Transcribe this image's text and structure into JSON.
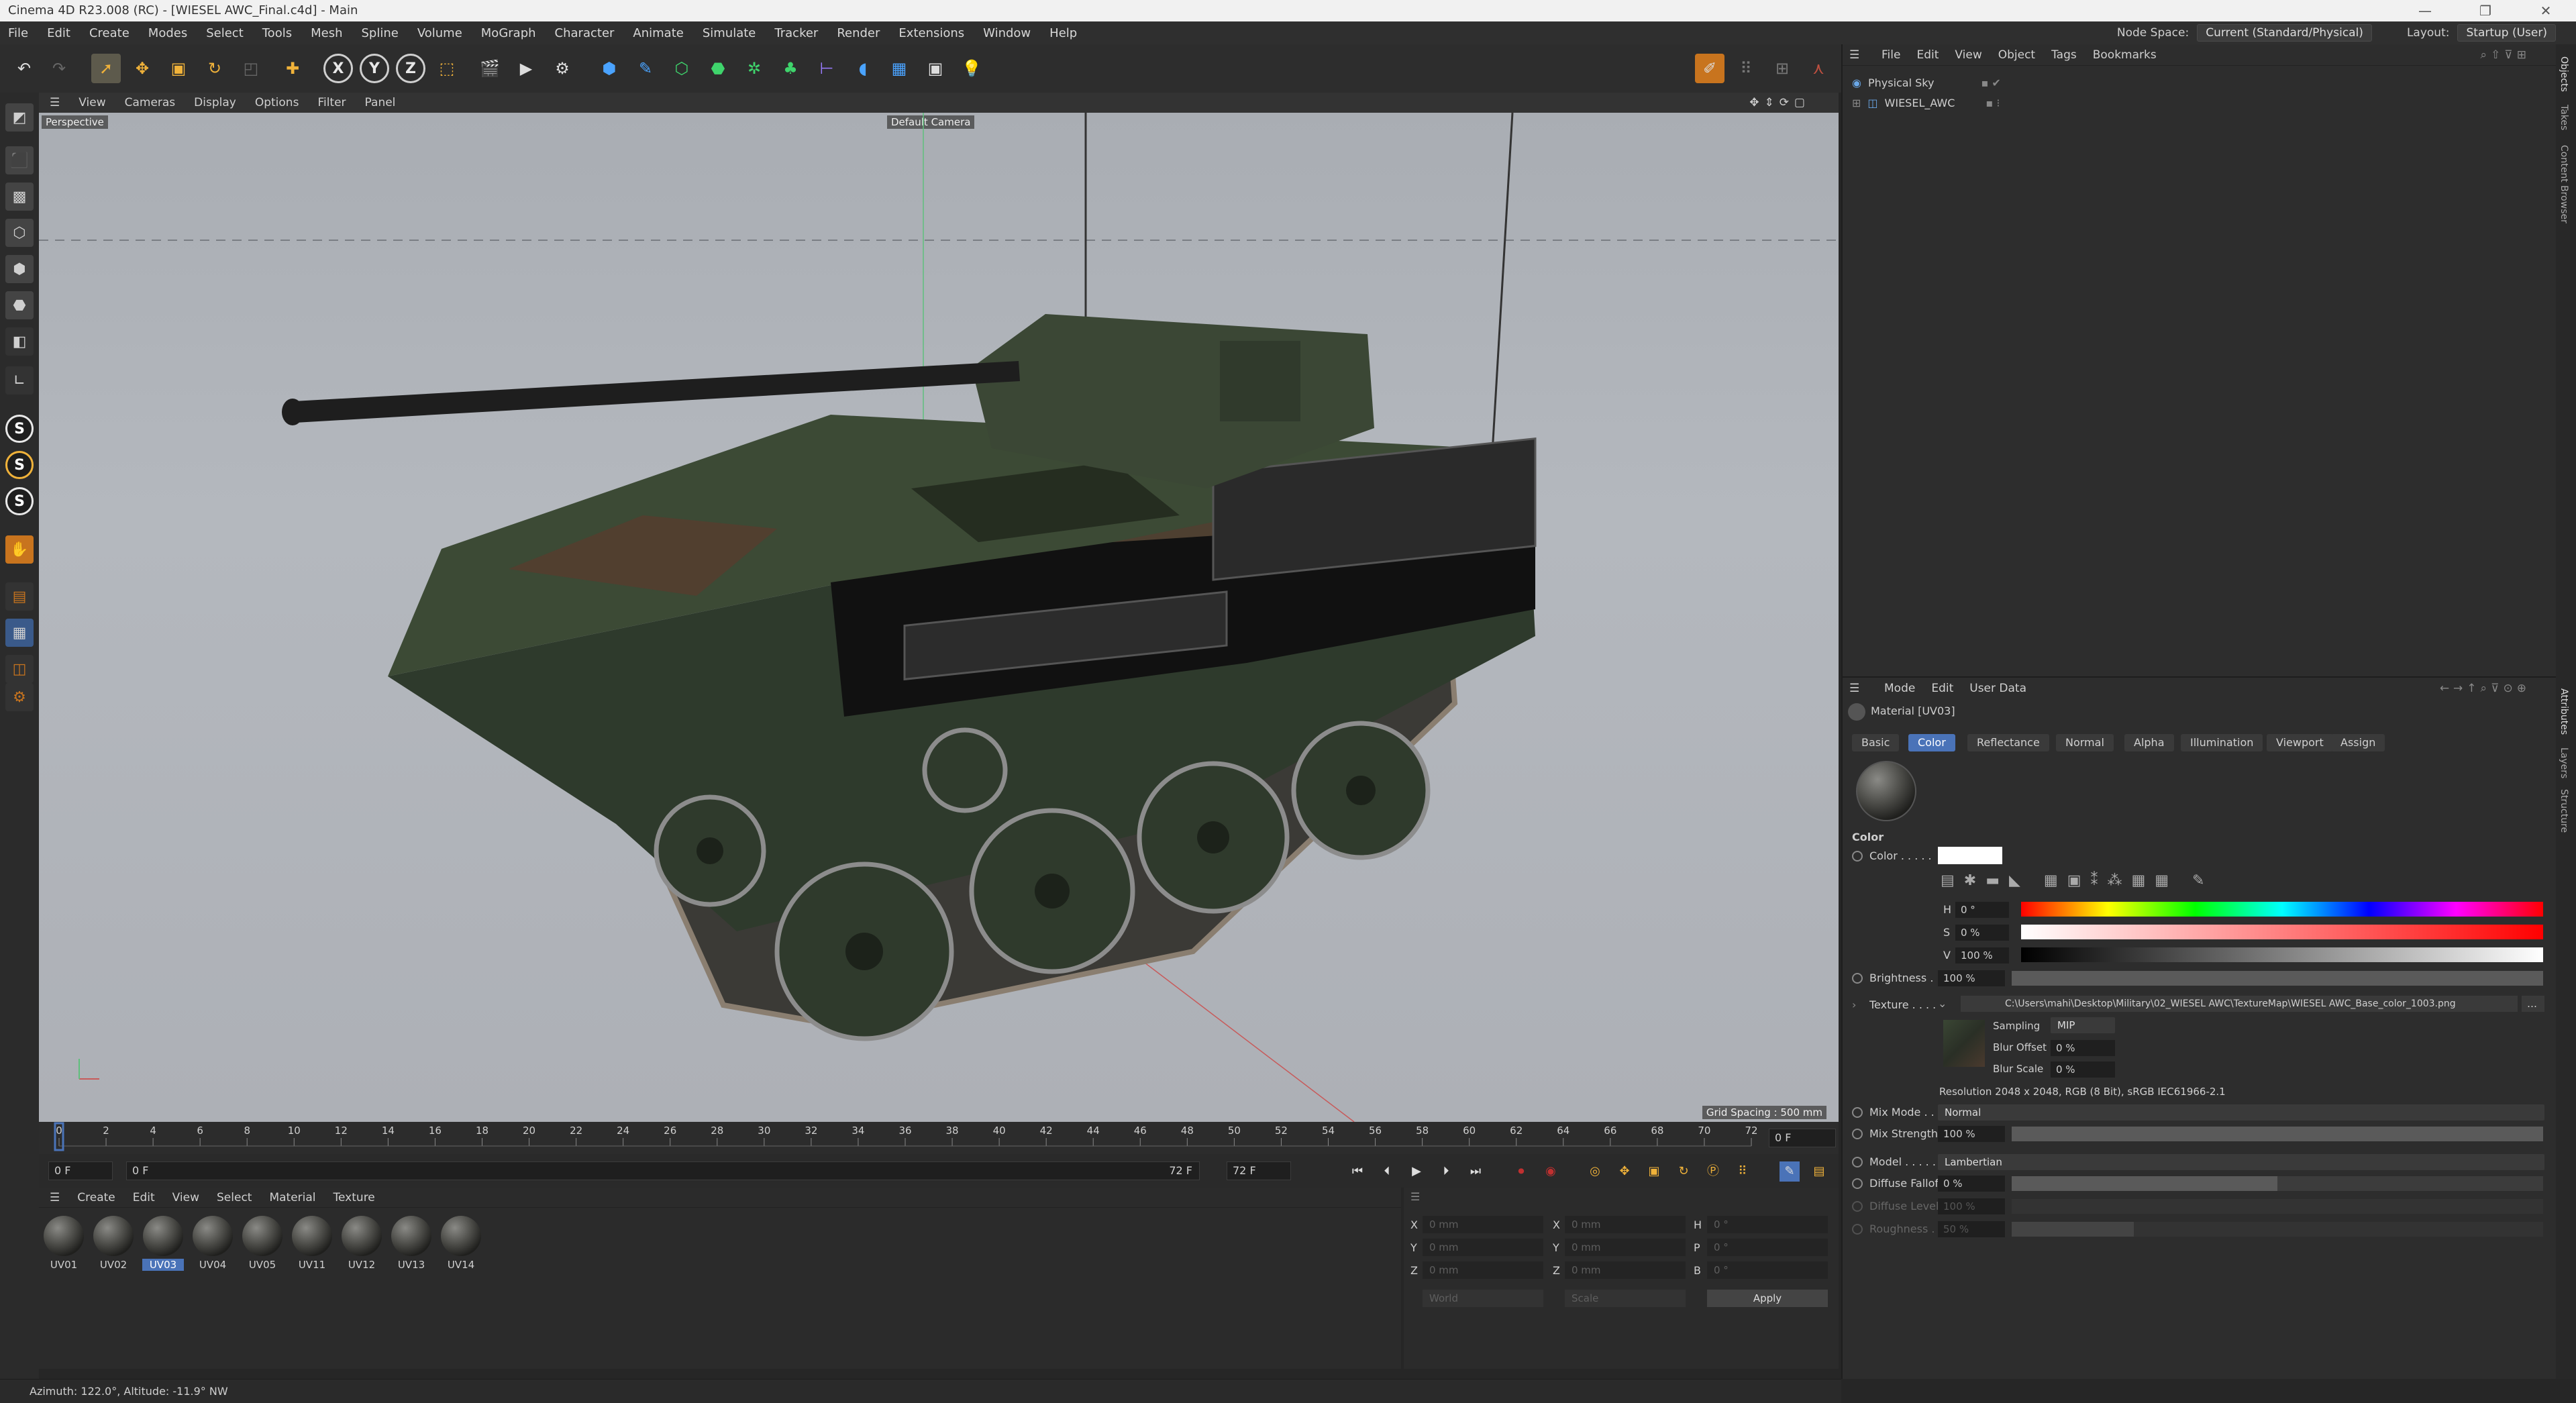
{
  "window": {
    "title": "Cinema 4D R23.008 (RC) - [WIESEL AWC_Final.c4d] - Main",
    "controls": [
      "—",
      "❐",
      "✕"
    ]
  },
  "menubar": {
    "items": [
      "File",
      "Edit",
      "Create",
      "Modes",
      "Select",
      "Tools",
      "Mesh",
      "Spline",
      "Volume",
      "MoGraph",
      "Character",
      "Animate",
      "Simulate",
      "Tracker",
      "Render",
      "Extensions",
      "Window",
      "Help"
    ],
    "node_space_label": "Node Space:",
    "node_space_value": "Current (Standard/Physical)",
    "layout_label": "Layout:",
    "layout_value": "Startup (User)"
  },
  "toolbar": {
    "axis_x": "X",
    "axis_y": "Y",
    "axis_z": "Z"
  },
  "leftbar": {
    "s_buttons": [
      "S",
      "S",
      "S"
    ]
  },
  "viewport": {
    "menu": [
      "View",
      "Cameras",
      "Display",
      "Options",
      "Filter",
      "Panel"
    ],
    "projection": "Perspective",
    "camera": "Default Camera",
    "grid_spacing": "Grid Spacing : 500 mm"
  },
  "timeline": {
    "ticks": [
      "0",
      "2",
      "4",
      "6",
      "8",
      "10",
      "12",
      "14",
      "16",
      "18",
      "20",
      "22",
      "24",
      "26",
      "28",
      "30",
      "32",
      "34",
      "36",
      "38",
      "40",
      "42",
      "44",
      "46",
      "48",
      "50",
      "52",
      "54",
      "56",
      "58",
      "60",
      "62",
      "64",
      "66",
      "68",
      "70",
      "72"
    ],
    "current_frame": "0 F",
    "start": "0 F",
    "preview_start": "0 F",
    "end": "72 F",
    "preview_end": "72 F"
  },
  "material_manager": {
    "menu": [
      "Create",
      "Edit",
      "View",
      "Select",
      "Material",
      "Texture"
    ],
    "materials": [
      "UV01",
      "UV02",
      "UV03",
      "UV04",
      "UV05",
      "UV11",
      "UV12",
      "UV13",
      "UV14"
    ],
    "selected": "UV03"
  },
  "coordinates": {
    "rows": [
      {
        "a": "X",
        "av": "0 mm",
        "b": "X",
        "bv": "0 mm",
        "c": "H",
        "cv": "0 °"
      },
      {
        "a": "Y",
        "av": "0 mm",
        "b": "Y",
        "bv": "0 mm",
        "c": "P",
        "cv": "0 °"
      },
      {
        "a": "Z",
        "av": "0 mm",
        "b": "Z",
        "bv": "0 mm",
        "c": "B",
        "cv": "0 °"
      }
    ],
    "world": "World",
    "scale": "Scale",
    "apply": "Apply"
  },
  "status": "Azimuth: 122.0°, Altitude: -11.9°  NW",
  "object_manager": {
    "menu": [
      "File",
      "Edit",
      "View",
      "Object",
      "Tags",
      "Bookmarks"
    ],
    "objects": [
      "Physical Sky",
      "WIESEL_AWC"
    ]
  },
  "side_tabs_top": [
    "Objects",
    "Takes",
    "Content Browser"
  ],
  "side_tabs_bottom": [
    "Attributes",
    "Layers",
    "Structure"
  ],
  "attributes": {
    "menu": [
      "Mode",
      "Edit",
      "User Data"
    ],
    "title": "Material [UV03]",
    "tabs": [
      "Basic",
      "Color",
      "Reflectance",
      "Normal",
      "Alpha",
      "Illumination",
      "Viewport",
      "Assign"
    ],
    "active_tab": "Color",
    "section": "Color",
    "color_label": "Color . . . . .",
    "h_label": "H",
    "h_value": "0 °",
    "s_label": "S",
    "s_value": "0 %",
    "v_label": "V",
    "v_value": "100 %",
    "brightness_label": "Brightness . .",
    "brightness_value": "100 %",
    "texture_label": "Texture . . . .",
    "texture_path": "C:\\Users\\mahi\\Desktop\\Military\\02_WIESEL AWC\\TextureMap\\WIESEL AWC_Base_color_1003.png",
    "sampling_label": "Sampling",
    "sampling_value": "MIP",
    "blur_offset_label": "Blur Offset",
    "blur_offset_value": "0 %",
    "blur_scale_label": "Blur Scale",
    "blur_scale_value": "0 %",
    "resolution": "Resolution 2048 x 2048, RGB (8 Bit), sRGB IEC61966-2.1",
    "mix_mode_label": "Mix Mode . . .",
    "mix_mode_value": "Normal",
    "mix_strength_label": "Mix Strength",
    "mix_strength_value": "100 %",
    "model_label": "Model . . . . .",
    "model_value": "Lambertian",
    "diffuse_falloff_label": "Diffuse Falloff",
    "diffuse_falloff_value": "0 %",
    "diffuse_level_label": "Diffuse Level",
    "diffuse_level_value": "100 %",
    "roughness_label": "Roughness . .",
    "roughness_value": "50 %"
  },
  "colors": {
    "accent": "#4a73b8",
    "ui_dark": "#2d2d2d",
    "orange": "#c8741e"
  }
}
